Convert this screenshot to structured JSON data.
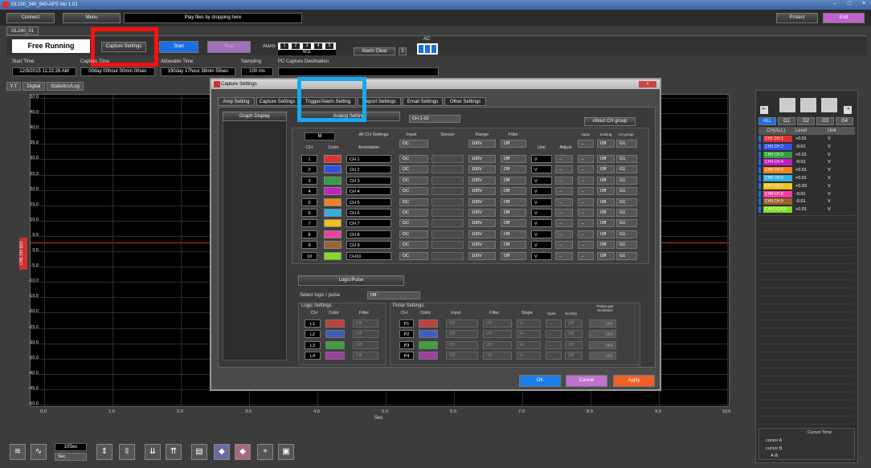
{
  "window": {
    "title": "GL100_240_840-APS Ver 1.01"
  },
  "topbar": {
    "connect": "Connect",
    "menu": "Menu",
    "drop_hint": "Play files by dropping here",
    "protect": "Protect",
    "end": "End"
  },
  "device_tab": "GL240_01",
  "controls": {
    "status": "Free Running",
    "capture_settings": "Capture Settings",
    "start": "Start",
    "stop": "Stop",
    "alarm_label": "Alarm",
    "alarm_boxes": [
      "1",
      "2",
      "3",
      "4",
      "5"
    ],
    "alarm_sub": "W11",
    "alarm_clear": "Alarm Clear",
    "ac_label": "AC"
  },
  "info": {
    "start_time_label": "Start Time",
    "start_time": "12/9/2015 11:22:26 AM",
    "capture_time_label": "Capture Time",
    "capture_time": "00day 00hour 00min 00sec",
    "allowable_time_label": "Allowable Time",
    "allowable_time": "190day 17hour 38min 59sec",
    "sampling_label": "Sampling",
    "sampling": "100 ms",
    "pc_dest_label": "PC Capture Destination"
  },
  "view_tabs": [
    "Y-T",
    "Digital",
    "Statistics/Log"
  ],
  "graph": {
    "y_ticks": [
      "50.0",
      "45.0",
      "40.0",
      "35.0",
      "30.0",
      "25.0",
      "20.0",
      "15.0",
      "10.0",
      "5.0",
      "0.0",
      "-5.0",
      "-10.0",
      "-15.0",
      "-20.0",
      "-25.0",
      "-30.0",
      "-35.0",
      "-40.0",
      "-45.0",
      "-50.0"
    ],
    "x_ticks": [
      "0.0",
      "1.0",
      "2.0",
      "3.0",
      "4.0",
      "5.0",
      "6.0",
      "7.0",
      "8.0",
      "9.0",
      "10.0"
    ],
    "x_unit": "Sec",
    "channel_label": "CH1  CH 1[V]"
  },
  "dialog": {
    "title": "Capture Settings",
    "tabs": [
      "Amp Setting",
      "Capture Settings",
      "Trigger/Alarm Setting",
      "Report Settings",
      "Email Settings",
      "Other Settings"
    ],
    "graph_display": "Graph Display",
    "analog_settings": "Analog Settings",
    "ch_range": "CH 1-10",
    "about_ch_group": "About CH group",
    "m_label": "M",
    "all_ch_settings": "All CH Settings",
    "headers": {
      "ch": "CH",
      "color": "Color",
      "annotation": "Annotation",
      "input": "Input",
      "sensor": "Sensor",
      "range": "Range",
      "filter": "Filter",
      "unit": "Unit",
      "adjust": "Adjust",
      "span": "Span",
      "scaling": "Scaling",
      "ch_group": "CH group"
    },
    "all_row": {
      "input": "DC",
      "range": "100V",
      "filter": "Off",
      "scaling": "Off",
      "group": "G1"
    },
    "rows": [
      {
        "ch": "1",
        "color": "#e03030",
        "ann": "CH 1",
        "input": "DC",
        "range": "100V",
        "filter": "Off",
        "unit": "V",
        "scaling": "Off",
        "group": "G1"
      },
      {
        "ch": "2",
        "color": "#3050e0",
        "ann": "CH 2",
        "input": "DC",
        "range": "100V",
        "filter": "Off",
        "unit": "V",
        "scaling": "Off",
        "group": "G1"
      },
      {
        "ch": "3",
        "color": "#30a040",
        "ann": "CH 3",
        "input": "DC",
        "range": "100V",
        "filter": "Off",
        "unit": "V",
        "scaling": "Off",
        "group": "G1"
      },
      {
        "ch": "4",
        "color": "#c020c0",
        "ann": "CH 4",
        "input": "DC",
        "range": "100V",
        "filter": "Off",
        "unit": "V",
        "scaling": "Off",
        "group": "G1"
      },
      {
        "ch": "5",
        "color": "#f08020",
        "ann": "CH 5",
        "input": "DC",
        "range": "100V",
        "filter": "Off",
        "unit": "V",
        "scaling": "Off",
        "group": "G1"
      },
      {
        "ch": "6",
        "color": "#30b0e0",
        "ann": "CH 6",
        "input": "DC",
        "range": "100V",
        "filter": "Off",
        "unit": "V",
        "scaling": "Off",
        "group": "G1"
      },
      {
        "ch": "7",
        "color": "#f0c020",
        "ann": "CH 7",
        "input": "DC",
        "range": "100V",
        "filter": "Off",
        "unit": "V",
        "scaling": "Off",
        "group": "G1"
      },
      {
        "ch": "8",
        "color": "#f040a0",
        "ann": "CH 8",
        "input": "DC",
        "range": "100V",
        "filter": "Off",
        "unit": "V",
        "scaling": "Off",
        "group": "G1"
      },
      {
        "ch": "9",
        "color": "#a06030",
        "ann": "CH 9",
        "input": "DC",
        "range": "100V",
        "filter": "Off",
        "unit": "V",
        "scaling": "Off",
        "group": "G1"
      },
      {
        "ch": "10",
        "color": "#80e020",
        "ann": "CH10",
        "input": "DC",
        "range": "100V",
        "filter": "Off",
        "unit": "V",
        "scaling": "Off",
        "group": "G1"
      }
    ],
    "logic_pulse": "Logic/Pulse",
    "select_logic_label": "Select logic / pulse",
    "select_logic_value": "Off",
    "logic_settings": "Logic Settings",
    "pulse_settings": "Pulse Settings",
    "logic_headers": {
      "ch": "CH",
      "color": "Color",
      "filter": "Filter"
    },
    "pulse_headers": {
      "ch": "CH",
      "color": "Color",
      "input": "Input",
      "filter": "Filter",
      "slope": "Slope",
      "span": "Span",
      "scaling": "Scaling",
      "ppr": "Pulses per revolution"
    },
    "logic_rows": [
      {
        "ch": "L1",
        "color": "#c04040",
        "filter": "Off"
      },
      {
        "ch": "L2",
        "color": "#4060c0",
        "filter": "Off"
      },
      {
        "ch": "L3",
        "color": "#40a040",
        "filter": "Off"
      },
      {
        "ch": "L4",
        "color": "#a040a0",
        "filter": "Off"
      }
    ],
    "pulse_rows": [
      {
        "ch": "P1",
        "color": "#c04040",
        "input": "Off",
        "filter": "Off",
        "slope": "H",
        "scaling": "Off",
        "ppr": "360"
      },
      {
        "ch": "P2",
        "color": "#4060c0",
        "input": "Off",
        "filter": "Off",
        "slope": "H",
        "scaling": "Off",
        "ppr": "360"
      },
      {
        "ch": "P3",
        "color": "#40a040",
        "input": "Off",
        "filter": "Off",
        "slope": "H",
        "scaling": "Off",
        "ppr": "360"
      },
      {
        "ch": "P4",
        "color": "#a040a0",
        "input": "Off",
        "filter": "Off",
        "slope": "H",
        "scaling": "Off",
        "ppr": "360"
      }
    ],
    "ok": "OK",
    "cancel": "Cancel",
    "apply": "Apply"
  },
  "sidebar": {
    "group_tabs": [
      "ALL",
      "G1",
      "G2",
      "G3",
      "G4"
    ],
    "headers": [
      "CH(ALL)",
      "Level",
      "Unit"
    ],
    "rows": [
      {
        "name": "CH1  CH 1",
        "color": "#e03030",
        "level": "+0.01",
        "unit": "V"
      },
      {
        "name": "CH2  CH 2",
        "color": "#3050e0",
        "level": "-0.01",
        "unit": "V"
      },
      {
        "name": "CH3  CH 3",
        "color": "#30a040",
        "level": "+0.01",
        "unit": "V"
      },
      {
        "name": "CH4  CH 4",
        "color": "#c020c0",
        "level": "-0.01",
        "unit": "V"
      },
      {
        "name": "CH5  CH 5",
        "color": "#f08020",
        "level": "+0.01",
        "unit": "V"
      },
      {
        "name": "CH6  CH 6",
        "color": "#30b0e0",
        "level": "+0.01",
        "unit": "V"
      },
      {
        "name": "CH7  CH 7",
        "color": "#f0c020",
        "level": "+0.03",
        "unit": "V"
      },
      {
        "name": "CH8  CH 8",
        "color": "#f040a0",
        "level": "-0.01",
        "unit": "V"
      },
      {
        "name": "CH9  CH 9",
        "color": "#a06030",
        "level": "-0.01",
        "unit": "V"
      },
      {
        "name": "CH10 CH10",
        "color": "#80e020",
        "level": "+0.01",
        "unit": "V"
      }
    ],
    "cursor_time": "Cursor Time",
    "cursor_a": "cursor A",
    "cursor_b": "cursor B",
    "a_b": "A-B"
  },
  "bottom": {
    "time_div": "10Sec",
    "unit": "Sec"
  },
  "colors": {
    "highlight_red": "#ff1010",
    "highlight_blue": "#18a8f0",
    "start_btn": "#1a6fe0",
    "ok_btn": "#1a7fe8",
    "cancel_btn": "#c070d0",
    "apply_btn": "#f06020",
    "end_btn": "#c060d0"
  }
}
